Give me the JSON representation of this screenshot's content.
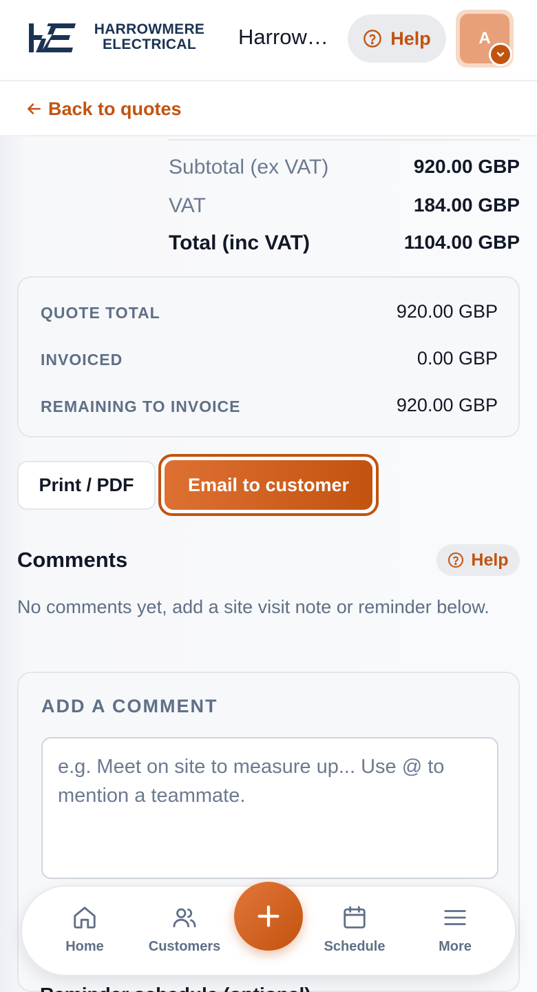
{
  "header": {
    "brand_line1": "HARROWMERE",
    "brand_line2": "ELECTRICAL",
    "title": "Harrowmere Electrical",
    "help_label": "Help",
    "avatar_initial": "A"
  },
  "nav_back": {
    "label": "Back to quotes"
  },
  "totals": [
    {
      "label": "Subtotal (ex VAT)",
      "value": "920.00 GBP"
    },
    {
      "label": "VAT",
      "value": "184.00 GBP"
    },
    {
      "label": "Total (inc VAT)",
      "value": "1104.00 GBP"
    }
  ],
  "summary": [
    {
      "label": "QUOTE TOTAL",
      "value": "920.00 GBP"
    },
    {
      "label": "INVOICED",
      "value": "0.00 GBP"
    },
    {
      "label": "REMAINING TO INVOICE",
      "value": "920.00 GBP"
    }
  ],
  "actions": {
    "print_label": "Print / PDF",
    "email_label": "Email to customer"
  },
  "comments": {
    "title": "Comments",
    "help_label": "Help",
    "empty_text": "No comments yet, add a site visit note or reminder below.",
    "add_label": "ADD A COMMENT",
    "input_placeholder": "e.g. Meet on site to measure up... Use @ to mention a teammate.",
    "next_section_label": "Reminder schedule (optional)"
  },
  "bottom_nav": {
    "home": "Home",
    "customers": "Customers",
    "schedule": "Schedule",
    "more": "More"
  },
  "colors": {
    "accent": "#c2530f",
    "brand_navy": "#1b3354",
    "muted_text": "#5f6f86"
  },
  "icons": {
    "help": "question-circle-icon",
    "back": "arrow-left-icon",
    "avatar_badge": "chevron-down-icon",
    "home": "home-icon",
    "customers": "users-icon",
    "add": "plus-icon",
    "schedule": "calendar-icon",
    "more": "menu-icon"
  }
}
